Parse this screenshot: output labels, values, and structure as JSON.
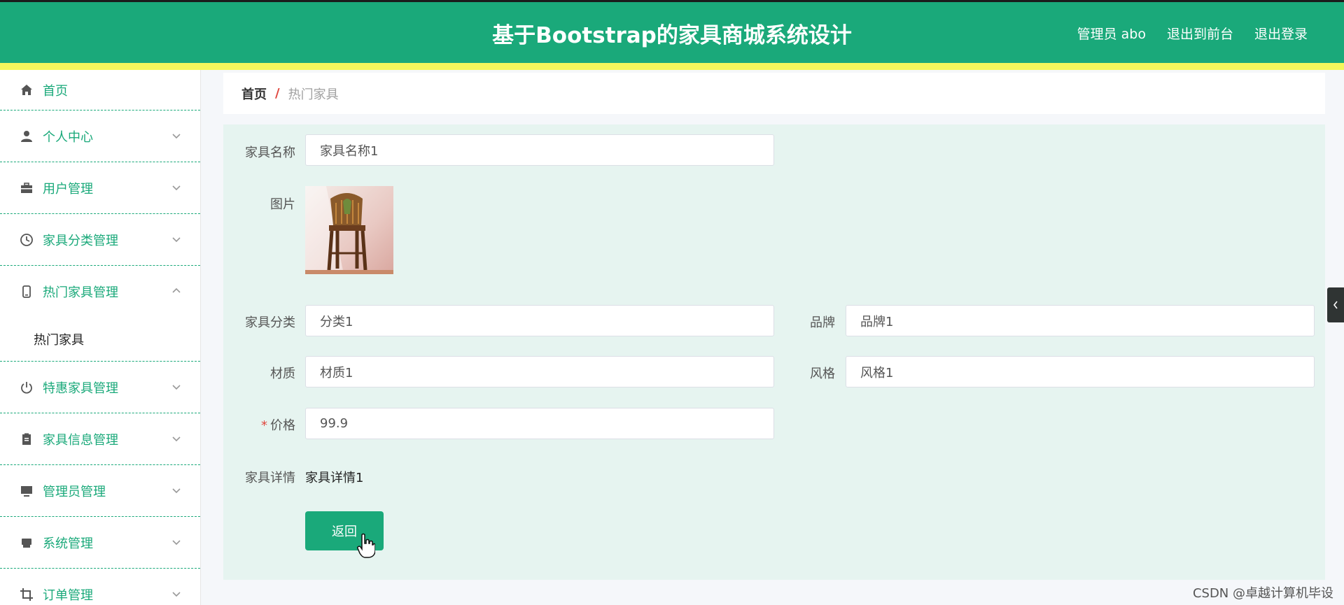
{
  "header": {
    "title": "基于Bootstrap的家具商城系统设计",
    "admin_label": "管理员 abo",
    "to_front": "退出到前台",
    "logout": "退出登录"
  },
  "sidebar": {
    "items": [
      {
        "label": "首页",
        "icon": "home-icon"
      },
      {
        "label": "个人中心",
        "icon": "user-icon"
      },
      {
        "label": "用户管理",
        "icon": "briefcase-icon"
      },
      {
        "label": "家具分类管理",
        "icon": "clock-icon"
      },
      {
        "label": "热门家具管理",
        "icon": "mobile-icon",
        "expanded": true
      },
      {
        "label": "特惠家具管理",
        "icon": "power-icon"
      },
      {
        "label": "家具信息管理",
        "icon": "clipboard-icon"
      },
      {
        "label": "管理员管理",
        "icon": "monitor-icon"
      },
      {
        "label": "系统管理",
        "icon": "printer-icon"
      },
      {
        "label": "订单管理",
        "icon": "crop-icon"
      }
    ],
    "submenu": {
      "label": "热门家具"
    }
  },
  "breadcrumb": {
    "home": "首页",
    "separator": "/",
    "current": "热门家具"
  },
  "form": {
    "name": {
      "label": "家具名称",
      "value": "家具名称1"
    },
    "image": {
      "label": "图片"
    },
    "category": {
      "label": "家具分类",
      "value": "分类1"
    },
    "brand": {
      "label": "品牌",
      "value": "品牌1"
    },
    "material": {
      "label": "材质",
      "value": "材质1"
    },
    "style": {
      "label": "风格",
      "value": "风格1"
    },
    "price": {
      "required_mark": "*",
      "label": "价格",
      "value": "99.9"
    },
    "detail": {
      "label": "家具详情",
      "value": "家具详情1"
    },
    "back_button": "返回"
  },
  "watermark": "CSDN @卓越计算机毕设",
  "colors": {
    "primary": "#1aa97a",
    "accent_strip": "#f3f75c",
    "panel": "#e6f4f0",
    "required": "#e0463e"
  }
}
